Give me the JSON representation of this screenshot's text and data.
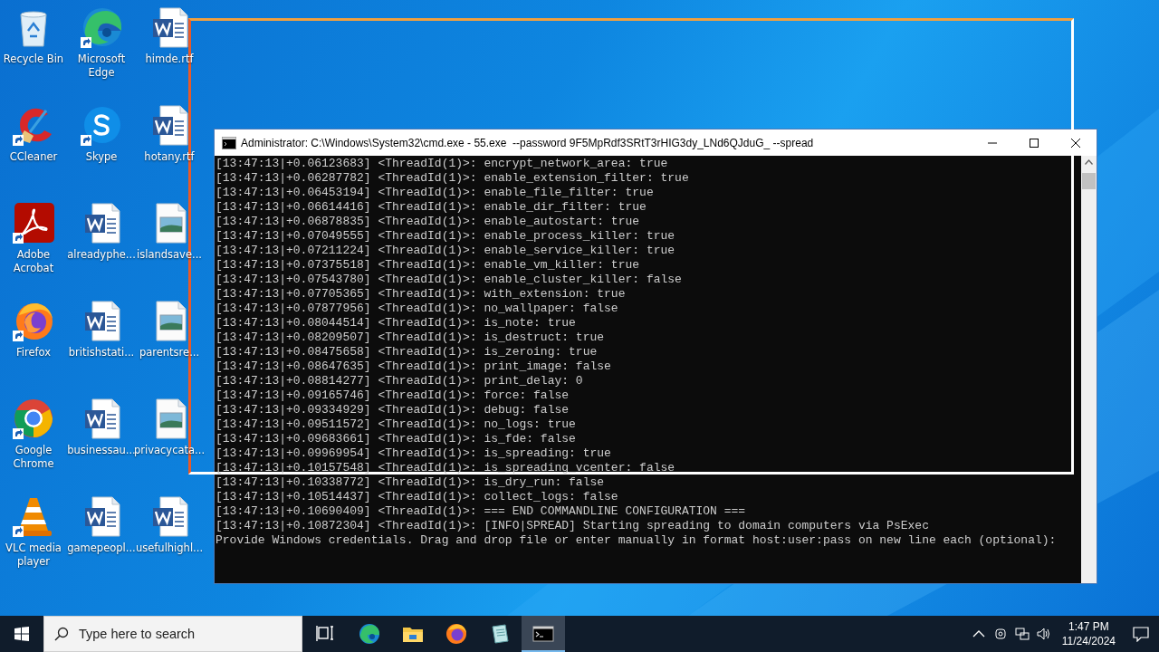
{
  "desktop": {
    "icons": [
      {
        "label": "Recycle Bin",
        "kind": "recycle-bin",
        "shortcut": false
      },
      {
        "label": "CCleaner",
        "kind": "ccleaner",
        "shortcut": true
      },
      {
        "label": "Adobe Acrobat",
        "kind": "acrobat",
        "shortcut": true
      },
      {
        "label": "Firefox",
        "kind": "firefox",
        "shortcut": true
      },
      {
        "label": "Google Chrome",
        "kind": "chrome",
        "shortcut": true
      },
      {
        "label": "VLC media player",
        "kind": "vlc",
        "shortcut": true
      },
      {
        "label": "Microsoft Edge",
        "kind": "edge",
        "shortcut": true
      },
      {
        "label": "Skype",
        "kind": "skype",
        "shortcut": true
      },
      {
        "label": "alreadyphe...",
        "kind": "word-doc",
        "shortcut": false
      },
      {
        "label": "britishstati...",
        "kind": "word-doc",
        "shortcut": false
      },
      {
        "label": "businessau...",
        "kind": "word-doc",
        "shortcut": false
      },
      {
        "label": "gamepeopl...",
        "kind": "word-doc",
        "shortcut": false
      },
      {
        "label": "himde.rtf",
        "kind": "word-doc",
        "shortcut": false
      },
      {
        "label": "hotany.rtf",
        "kind": "word-doc",
        "shortcut": false
      },
      {
        "label": "islandsave...",
        "kind": "image-file",
        "shortcut": false
      },
      {
        "label": "parentsre...",
        "kind": "image-file",
        "shortcut": false
      },
      {
        "label": "privacycata...",
        "kind": "image-file",
        "shortcut": false
      },
      {
        "label": "usefulhighl...",
        "kind": "word-doc",
        "shortcut": false
      }
    ]
  },
  "window": {
    "title": "Administrator: C:\\Windows\\System32\\cmd.exe - 55.exe  --password 9F5MpRdf3SRtT3rHIG3dy_LNd6QJduG_ --spread",
    "console": {
      "lines": [
        "[13:47:13|+0.06123683] <ThreadId(1)>: encrypt_network_area: true",
        "[13:47:13|+0.06287782] <ThreadId(1)>: enable_extension_filter: true",
        "[13:47:13|+0.06453194] <ThreadId(1)>: enable_file_filter: true",
        "[13:47:13|+0.06614416] <ThreadId(1)>: enable_dir_filter: true",
        "[13:47:13|+0.06878835] <ThreadId(1)>: enable_autostart: true",
        "[13:47:13|+0.07049555] <ThreadId(1)>: enable_process_killer: true",
        "[13:47:13|+0.07211224] <ThreadId(1)>: enable_service_killer: true",
        "[13:47:13|+0.07375518] <ThreadId(1)>: enable_vm_killer: true",
        "[13:47:13|+0.07543780] <ThreadId(1)>: enable_cluster_killer: false",
        "[13:47:13|+0.07705365] <ThreadId(1)>: with_extension: true",
        "[13:47:13|+0.07877956] <ThreadId(1)>: no_wallpaper: false",
        "[13:47:13|+0.08044514] <ThreadId(1)>: is_note: true",
        "[13:47:13|+0.08209507] <ThreadId(1)>: is_destruct: true",
        "[13:47:13|+0.08475658] <ThreadId(1)>: is_zeroing: true",
        "[13:47:13|+0.08647635] <ThreadId(1)>: print_image: false",
        "[13:47:13|+0.08814277] <ThreadId(1)>: print_delay: 0",
        "[13:47:13|+0.09165746] <ThreadId(1)>: force: false",
        "[13:47:13|+0.09334929] <ThreadId(1)>: debug: false",
        "[13:47:13|+0.09511572] <ThreadId(1)>: no_logs: true",
        "[13:47:13|+0.09683661] <ThreadId(1)>: is_fde: false",
        "[13:47:13|+0.09969954] <ThreadId(1)>: is_spreading: true",
        "[13:47:13|+0.10157548] <ThreadId(1)>: is_spreading_vcenter: false",
        "[13:47:13|+0.10338772] <ThreadId(1)>: is_dry_run: false",
        "[13:47:13|+0.10514437] <ThreadId(1)>: collect_logs: false",
        "[13:47:13|+0.10690409] <ThreadId(1)>: === END COMMANDLINE CONFIGURATION ===",
        "[13:47:13|+0.10872304] <ThreadId(1)>: [INFO|SPREAD] Starting spreading to domain computers via PsExec",
        "Provide Windows credentials. Drag and drop file or enter manually in format host:user:pass on new line each (optional):"
      ]
    }
  },
  "taskbar": {
    "search": {
      "placeholder": "Type here to search"
    },
    "apps": [
      {
        "kind": "task-view",
        "selected": false
      },
      {
        "kind": "edge",
        "selected": false
      },
      {
        "kind": "file-explorer",
        "selected": false
      },
      {
        "kind": "firefox",
        "selected": false
      },
      {
        "kind": "notepad",
        "selected": false
      },
      {
        "kind": "cmd",
        "selected": true
      }
    ],
    "clock": {
      "time": "1:47 PM",
      "date": "11/24/2024"
    }
  }
}
